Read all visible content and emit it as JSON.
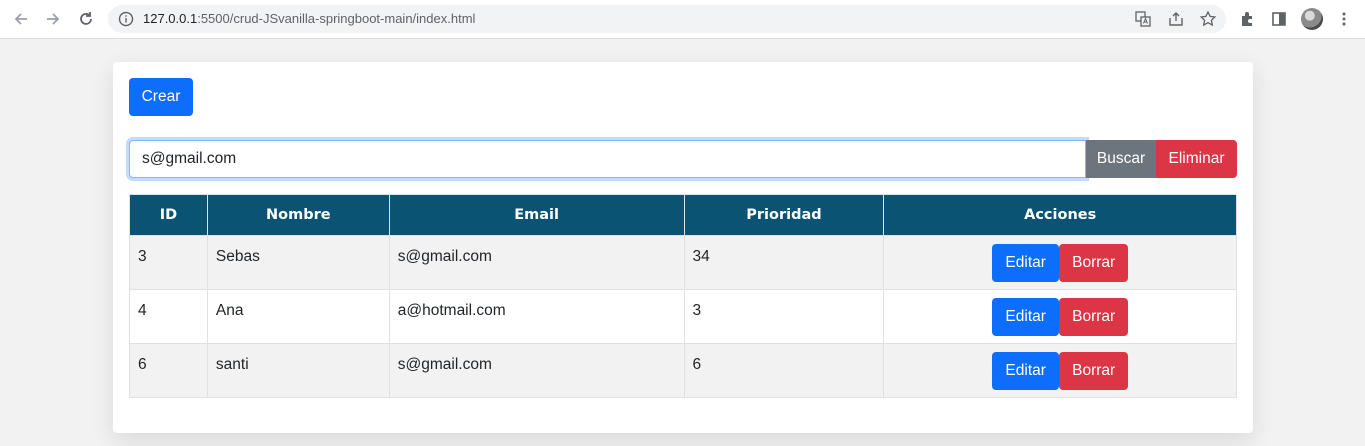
{
  "browser": {
    "url_host": "127.0.0.1",
    "url_path": ":5500/crud-JSvanilla-springboot-main/index.html"
  },
  "page": {
    "create_label": "Crear",
    "search_value": "s@gmail.com",
    "search_label": "Buscar",
    "delete_label": "Eliminar"
  },
  "table": {
    "headers": [
      "ID",
      "Nombre",
      "Email",
      "Prioridad",
      "Acciones"
    ],
    "rows": [
      {
        "id": "3",
        "nombre": "Sebas",
        "email": "s@gmail.com",
        "prioridad": "34"
      },
      {
        "id": "4",
        "nombre": "Ana",
        "email": "a@hotmail.com",
        "prioridad": "3"
      },
      {
        "id": "6",
        "nombre": "santi",
        "email": "s@gmail.com",
        "prioridad": "6"
      }
    ],
    "edit_label": "Editar",
    "remove_label": "Borrar"
  },
  "colors": {
    "primary": "#0d6efd",
    "danger": "#dc3545",
    "secondary": "#6c757d",
    "header": "#0b5373"
  }
}
